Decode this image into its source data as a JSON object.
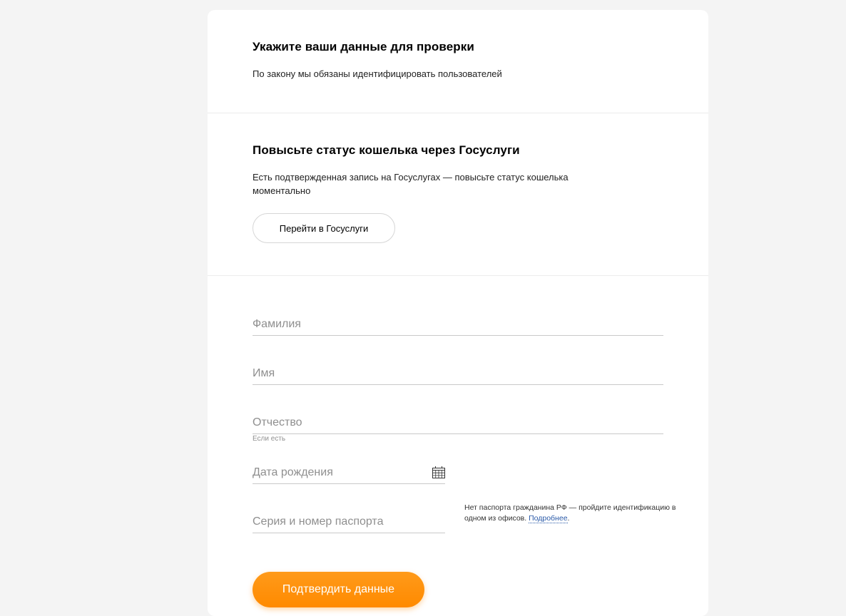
{
  "intro": {
    "title": "Укажите ваши данные для проверки",
    "description": "По закону мы обязаны идентифицировать пользователей"
  },
  "gosuslugi": {
    "title": "Повысьте статус кошелька через Госуслуги",
    "description": "Есть подтвержденная запись на Госуслугах — повысьте статус кошелька моментально",
    "button_label": "Перейти в Госуслуги"
  },
  "form": {
    "last_name": {
      "placeholder": "Фамилия",
      "value": ""
    },
    "first_name": {
      "placeholder": "Имя",
      "value": ""
    },
    "middle_name": {
      "placeholder": "Отчество",
      "value": "",
      "hint": "Если есть"
    },
    "birth_date": {
      "placeholder": "Дата рождения",
      "value": "",
      "icon": "calendar-icon"
    },
    "passport": {
      "placeholder": "Серия и номер паспорта",
      "value": ""
    },
    "passport_note": {
      "text": "Нет паспорта гражданина РФ — пройдите идентификацию в одном из офисов. ",
      "link_label": "Подробнее",
      "suffix": "."
    },
    "submit_label": "Подтвердить данные"
  },
  "colors": {
    "accent": "#ff8a00",
    "link": "#2a5aa8",
    "background": "#f4f4f4"
  }
}
